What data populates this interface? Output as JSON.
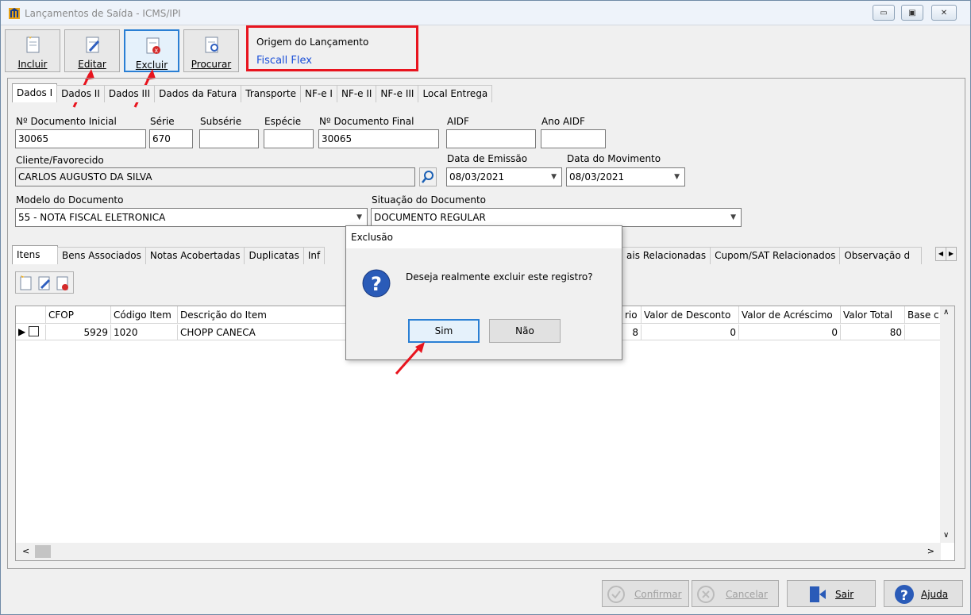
{
  "window": {
    "title": "Lançamentos de Saída - ICMS/IPI"
  },
  "toolbar": {
    "incluir": "Incluir",
    "editar": "Editar",
    "excluir": "Excluir",
    "procurar": "Procurar"
  },
  "origem": {
    "title": "Origem do Lançamento",
    "value": "Fiscall Flex"
  },
  "top_tabs": [
    "Dados I",
    "Dados II",
    "Dados III",
    "Dados da Fatura",
    "Transporte",
    "NF-e I",
    "NF-e II",
    "NF-e III",
    "Local Entrega"
  ],
  "form": {
    "num_doc_inicial_label": "Nº Documento Inicial",
    "num_doc_inicial": "30065",
    "serie_label": "Série",
    "serie": "670",
    "subserie_label": "Subsérie",
    "subserie": "",
    "especie_label": "Espécie",
    "especie": "",
    "num_doc_final_label": "Nº Documento Final",
    "num_doc_final": "30065",
    "aidf_label": "AIDF",
    "aidf": "",
    "ano_aidf_label": "Ano AIDF",
    "ano_aidf": "",
    "cliente_label": "Cliente/Favorecido",
    "cliente": "CARLOS AUGUSTO DA SILVA",
    "data_emissao_label": "Data de Emissão",
    "data_emissao": "08/03/2021",
    "data_movimento_label": "Data do Movimento",
    "data_movimento": "08/03/2021",
    "modelo_label": "Modelo do Documento",
    "modelo": "55 - NOTA FISCAL ELETRONICA",
    "situacao_label": "Situação do Documento",
    "situacao": "DOCUMENTO REGULAR"
  },
  "bottom_tabs": [
    "Itens",
    "Bens Associados",
    "Notas Acobertadas",
    "Duplicatas",
    "Inf",
    "ais Relacionadas",
    "Cupom/SAT Relacionados",
    "Observação d"
  ],
  "grid": {
    "headers": [
      "CFOP",
      "Código Item",
      "Descrição do Item",
      "rio",
      "Valor de Desconto",
      "Valor de Acréscimo",
      "Valor Total",
      "Base c"
    ],
    "row": {
      "cfop": "5929",
      "codigo": "1020",
      "descricao": "CHOPP CANECA",
      "unit": "8",
      "desconto": "0",
      "acrescimo": "0",
      "total": "80"
    }
  },
  "dialog": {
    "title": "Exclusão",
    "message": "Deseja realmente excluir este registro?",
    "yes": "Sim",
    "no": "Não"
  },
  "bottom_buttons": {
    "confirmar": "Confirmar",
    "cancelar": "Cancelar",
    "sair": "Sair",
    "ajuda": "Ajuda"
  },
  "colors": {
    "accent": "#2a7fd4",
    "highlight": "#e8141e",
    "link": "#1a4fd8"
  }
}
